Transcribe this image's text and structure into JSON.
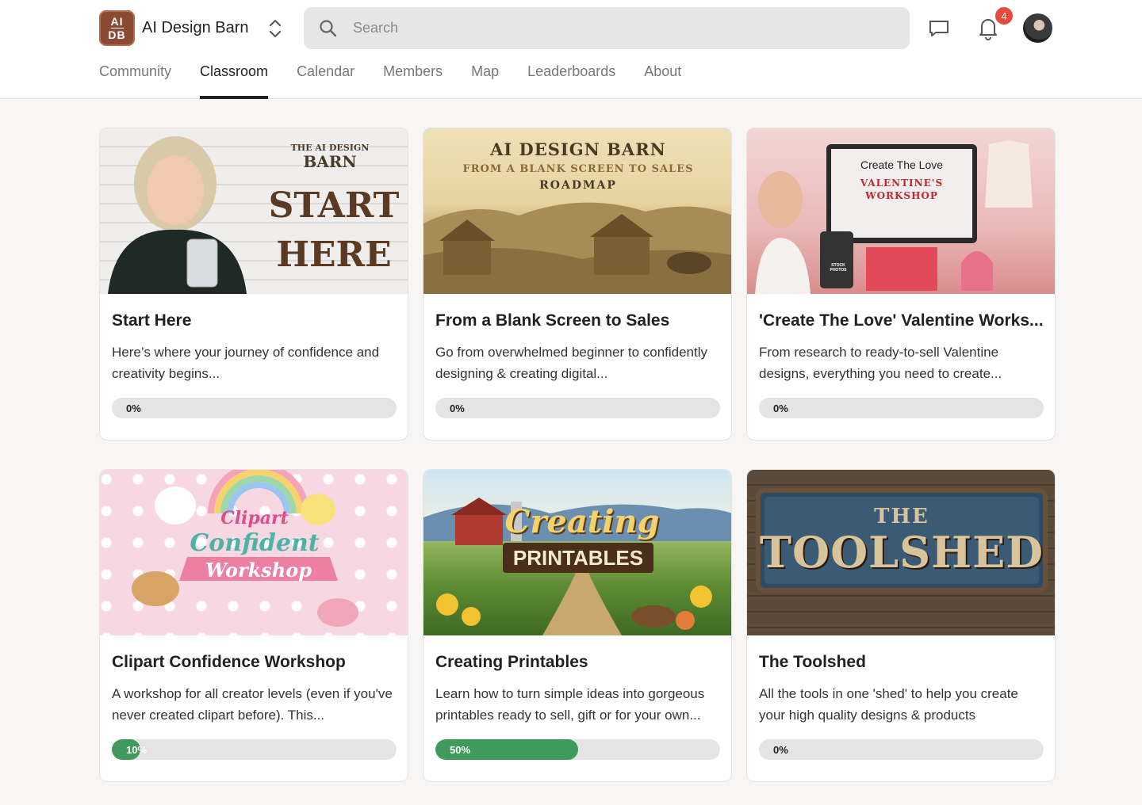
{
  "header": {
    "logo_line1": "AI",
    "logo_line2": "DB",
    "brand": "AI Design Barn",
    "search_placeholder": "Search",
    "notification_count": "4"
  },
  "tabs": [
    {
      "label": "Community",
      "active": false
    },
    {
      "label": "Classroom",
      "active": true
    },
    {
      "label": "Calendar",
      "active": false
    },
    {
      "label": "Members",
      "active": false
    },
    {
      "label": "Map",
      "active": false
    },
    {
      "label": "Leaderboards",
      "active": false
    },
    {
      "label": "About",
      "active": false
    }
  ],
  "courses": [
    {
      "title": "Start Here",
      "description": "Here’s where your journey of confidence and creativity begins...",
      "progress_label": "0%",
      "progress": 0,
      "thumb_text": {
        "brand_top": "THE AI DESIGN",
        "brand_bottom": "BARN",
        "line1": "START",
        "line2": "HERE"
      }
    },
    {
      "title": "From a Blank Screen to Sales",
      "description": "Go from overwhelmed beginner to confidently designing & creating digital...",
      "progress_label": "0%",
      "progress": 0,
      "thumb_text": {
        "line1": "AI DESIGN BARN",
        "line2": "FROM A BLANK SCREEN TO SALES",
        "line3": "ROADMAP"
      }
    },
    {
      "title": "'Create The Love' Valentine Works...",
      "description": "From research to ready-to-sell Valentine designs, everything you need to create...",
      "progress_label": "0%",
      "progress": 0,
      "thumb_text": {
        "line1": "Create The Love",
        "line2": "VALENTINE'S",
        "line3": "WORKSHOP",
        "stock": "STOCK PHOTOS"
      }
    },
    {
      "title": "Clipart Confidence Workshop",
      "description": "A workshop for all creator levels (even if you've never created clipart before). This...",
      "progress_label": "10%",
      "progress": 0.1,
      "thumb_text": {
        "line1": "Clipart",
        "line2": "Confident",
        "line3": "Workshop"
      }
    },
    {
      "title": "Creating Printables",
      "description": "Learn how to turn simple ideas into gorgeous printables ready to sell, gift or for your own...",
      "progress_label": "50%",
      "progress": 0.5,
      "thumb_text": {
        "line1": "Creating",
        "line2": "PRINTABLES"
      }
    },
    {
      "title": "The Toolshed",
      "description": "All the tools in one 'shed' to help you create your high quality designs & products",
      "progress_label": "0%",
      "progress": 0,
      "thumb_text": {
        "line1": "THE",
        "line2": "TOOLSHED"
      }
    }
  ],
  "colors": {
    "accent_progress": "#3f9a5c",
    "logo_brown": "#8b4a34",
    "badge_red": "#e54b3c"
  }
}
